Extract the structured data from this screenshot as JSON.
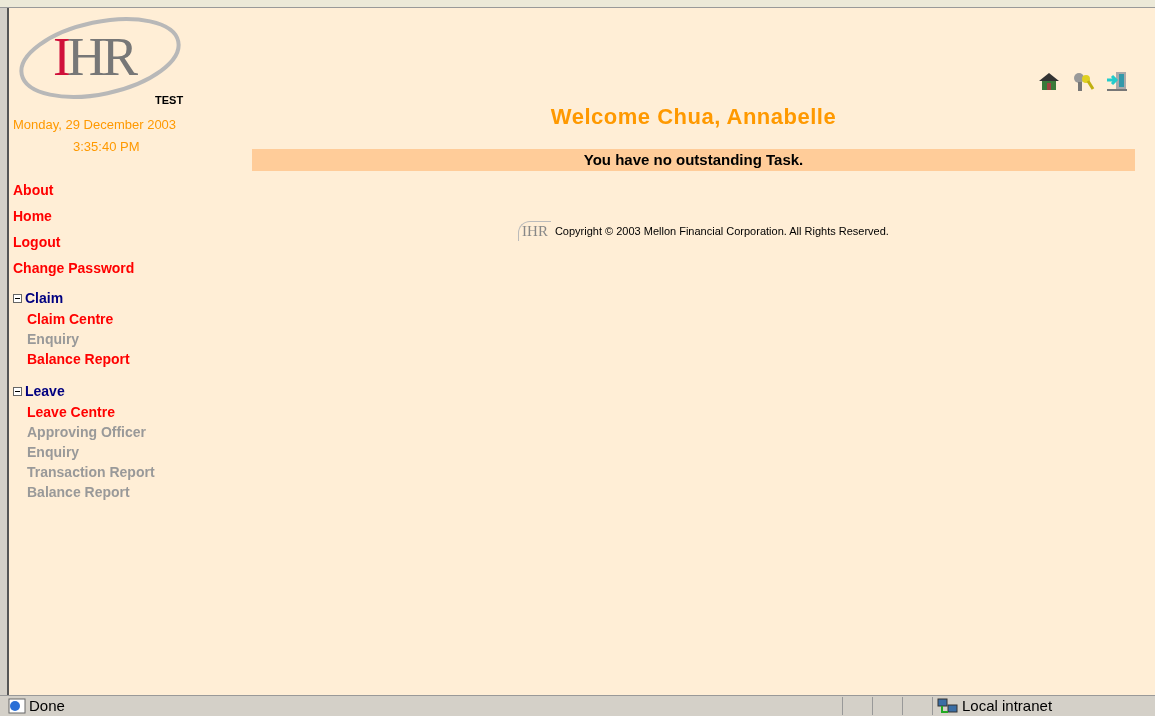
{
  "logo": {
    "text": "IHR",
    "tag": "TEST"
  },
  "date": "Monday, 29 December 2003",
  "time": "3:35:40 PM",
  "links": [
    "About",
    "Home",
    "Logout",
    "Change Password"
  ],
  "sections": [
    {
      "title": "Claim",
      "expanded": true,
      "items": [
        {
          "label": "Claim Centre",
          "disabled": false
        },
        {
          "label": "Enquiry",
          "disabled": true
        },
        {
          "label": "Balance Report",
          "disabled": false
        }
      ]
    },
    {
      "title": "Leave",
      "expanded": true,
      "items": [
        {
          "label": "Leave Centre",
          "disabled": false
        },
        {
          "label": "Approving Officer",
          "disabled": true
        },
        {
          "label": "Enquiry",
          "disabled": true
        },
        {
          "label": "Transaction Report",
          "disabled": true
        },
        {
          "label": "Balance Report",
          "disabled": true
        }
      ]
    }
  ],
  "welcome": "Welcome Chua, Annabelle",
  "task_message": "You have no outstanding Task.",
  "footer": {
    "logo_text": "IHR",
    "copyright": "Copyright © 2003 Mellon Financial Corporation. All Rights Reserved."
  },
  "status_bar": {
    "status": "Done",
    "zone": "Local intranet"
  }
}
